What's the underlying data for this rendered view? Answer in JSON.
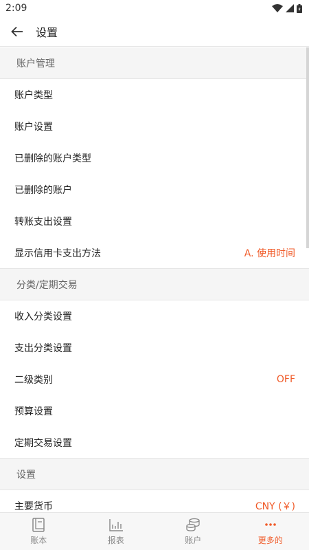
{
  "status_bar": {
    "time": "2:09"
  },
  "app_bar": {
    "title": "设置"
  },
  "sections": {
    "account": {
      "header": "账户管理",
      "items": [
        {
          "label": "账户类型",
          "value": ""
        },
        {
          "label": "账户设置",
          "value": ""
        },
        {
          "label": "已删除的账户类型",
          "value": ""
        },
        {
          "label": "已删除的账户",
          "value": ""
        },
        {
          "label": "转账支出设置",
          "value": ""
        },
        {
          "label": "显示信用卡支出方法",
          "value": "A. 使用时间"
        }
      ]
    },
    "category": {
      "header": "分类/定期交易",
      "items": [
        {
          "label": "收入分类设置",
          "value": ""
        },
        {
          "label": "支出分类设置",
          "value": ""
        },
        {
          "label": "二级类别",
          "value": "OFF"
        },
        {
          "label": "预算设置",
          "value": ""
        },
        {
          "label": "定期交易设置",
          "value": ""
        }
      ]
    },
    "settings": {
      "header": "设置",
      "items": [
        {
          "label": "主要货币",
          "value": "CNY (￥)"
        }
      ]
    }
  },
  "bottom_nav": [
    {
      "label": "账本",
      "icon": "book-icon",
      "active": false
    },
    {
      "label": "报表",
      "icon": "chart-icon",
      "active": false
    },
    {
      "label": "账户",
      "icon": "coins-icon",
      "active": false
    },
    {
      "label": "更多的",
      "icon": "more-icon",
      "active": true
    }
  ],
  "colors": {
    "accent": "#f05a28",
    "section_bg": "#f5f5f5",
    "nav_bg": "#f7f7f7"
  }
}
